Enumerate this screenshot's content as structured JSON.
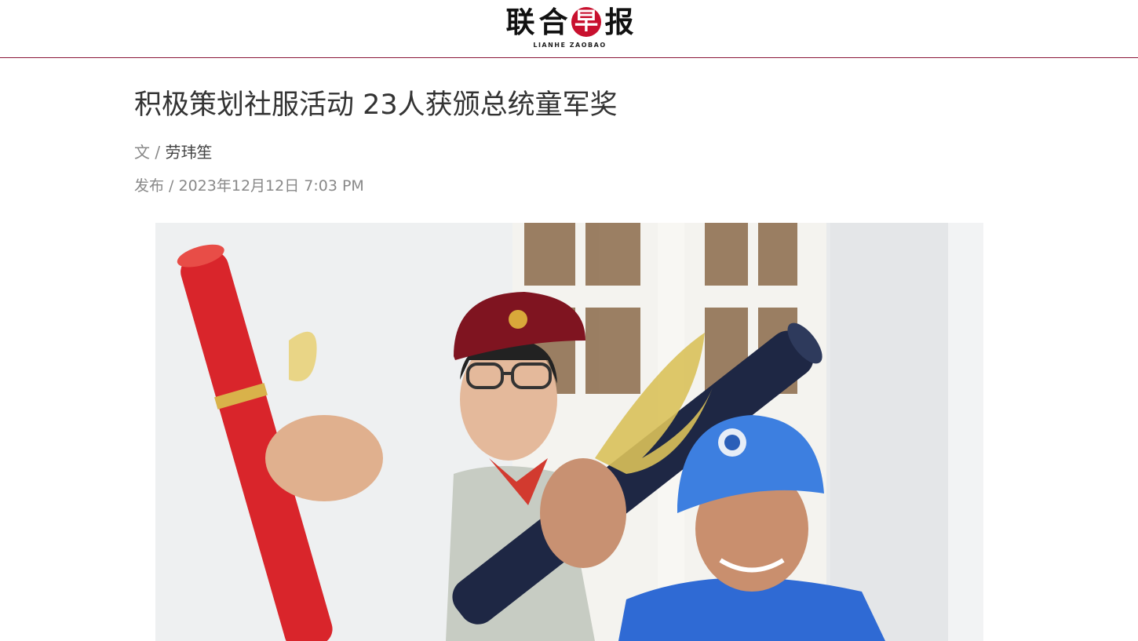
{
  "masthead": {
    "logo_chars": [
      "联",
      "合",
      "早",
      "报"
    ],
    "logo_en": "LIANHE ZAOBAO",
    "brand_color": "#c8102e",
    "rule_color": "#8a1538"
  },
  "article": {
    "headline": "积极策划社服活动 23人获颁总统童军奖",
    "byline_prefix": "文 /",
    "author": "劳玮笙",
    "published_prefix": "发布 /",
    "published_date": "2023年12月12日 7:03 PM"
  },
  "hero_image": {
    "subject": "photo"
  }
}
